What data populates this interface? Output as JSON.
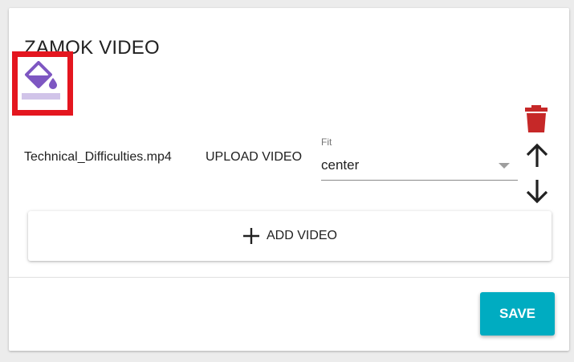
{
  "card": {
    "title": "ZAMOK VIDEO"
  },
  "video_item": {
    "filename": "Technical_Difficulties.mp4",
    "upload_label": "UPLOAD VIDEO",
    "fit": {
      "label": "Fit",
      "value": "center"
    }
  },
  "actions": {
    "add_video_label": "ADD VIDEO",
    "save_label": "SAVE"
  },
  "icons": {
    "paint": "format-color-fill-icon",
    "delete": "trash-icon",
    "move_up": "arrow-up-icon",
    "move_down": "arrow-down-icon",
    "add": "plus-icon"
  },
  "colors": {
    "accent": "#00acc1",
    "delete": "#c62828",
    "paint_icon": "#7e57c2",
    "paint_bar": "#d1c4e9",
    "highlight": "#e4161f"
  }
}
